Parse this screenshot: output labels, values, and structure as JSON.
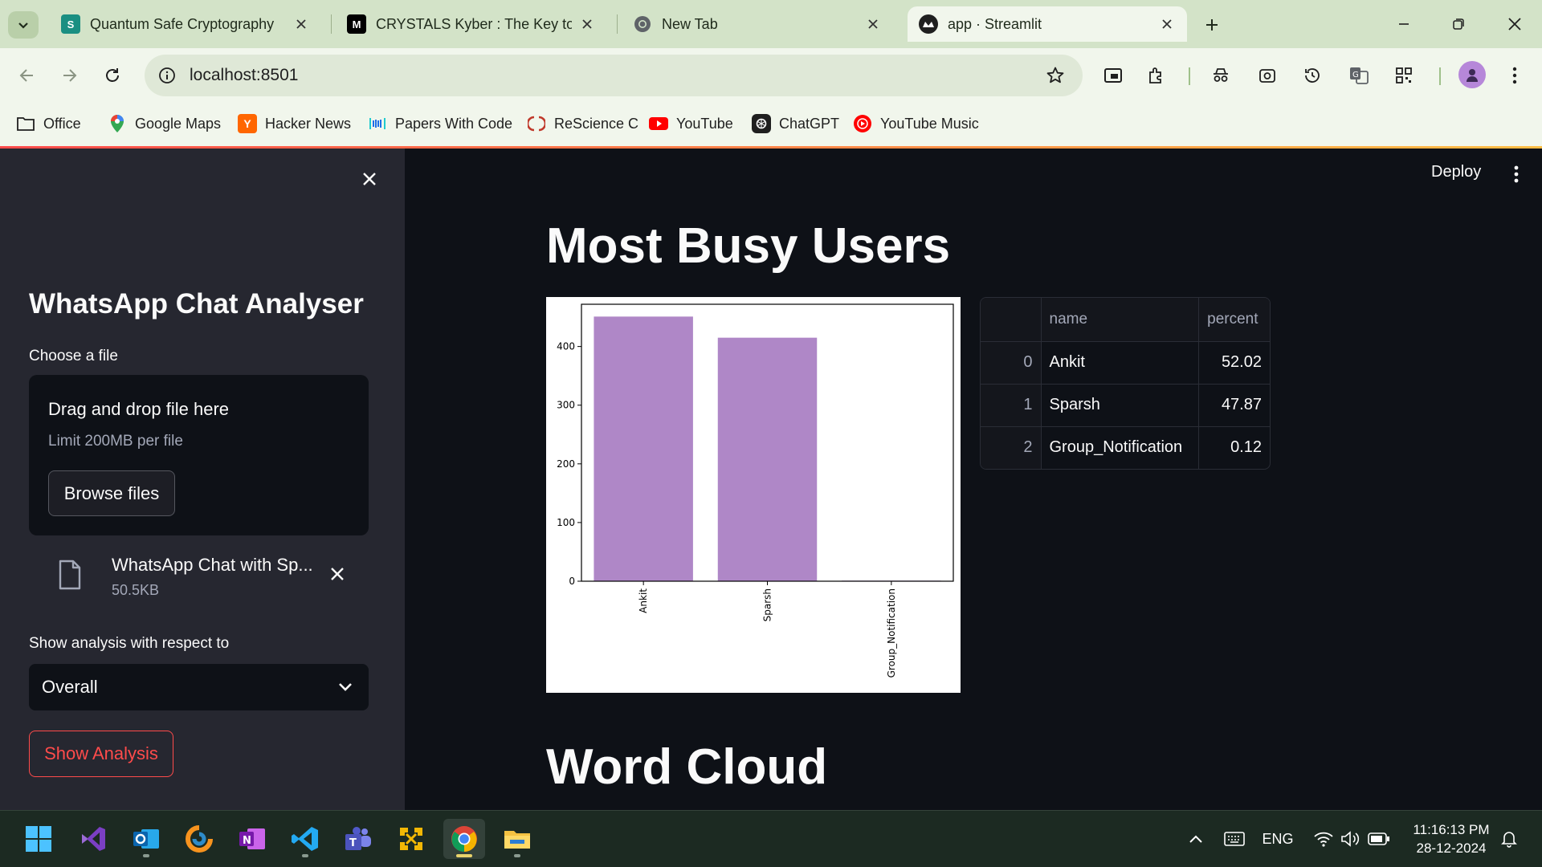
{
  "browser": {
    "tabs": [
      {
        "title": "Quantum Safe Cryptography",
        "icon": "sharepoint-icon"
      },
      {
        "title": "CRYSTALS Kyber : The Key to Po",
        "icon": "medium-icon"
      },
      {
        "title": "New Tab",
        "icon": "chrome-icon"
      },
      {
        "title": "app · Streamlit",
        "icon": "streamlit-icon"
      }
    ],
    "url": "localhost:8501",
    "bookmarks": [
      {
        "label": "Office",
        "icon": "folder-icon"
      },
      {
        "label": "Google Maps",
        "icon": "maps-icon"
      },
      {
        "label": "Hacker News",
        "icon": "hacker-news-icon"
      },
      {
        "label": "Papers With Code",
        "icon": "papers-with-code-icon"
      },
      {
        "label": "ReScience C",
        "icon": "rescience-icon"
      },
      {
        "label": "YouTube",
        "icon": "youtube-icon"
      },
      {
        "label": "ChatGPT",
        "icon": "chatgpt-icon"
      },
      {
        "label": "YouTube Music",
        "icon": "youtube-music-icon"
      }
    ]
  },
  "sidebar": {
    "title": "WhatsApp Chat Analyser",
    "uploader_label": "Choose a file",
    "dropzone_title": "Drag and drop file here",
    "dropzone_limit": "Limit 200MB per file",
    "browse_label": "Browse files",
    "file_name": "WhatsApp Chat with Sp...",
    "file_size": "50.5KB",
    "select_label": "Show analysis with respect to",
    "select_value": "Overall",
    "show_button": "Show Analysis"
  },
  "main": {
    "deploy_label": "Deploy",
    "heading": "Most Busy Users",
    "heading2": "Word Cloud",
    "table": {
      "columns": [
        "",
        "name",
        "percent"
      ],
      "rows": [
        {
          "index": "0",
          "name": "Ankit",
          "percent": "52.02"
        },
        {
          "index": "1",
          "name": "Sparsh",
          "percent": "47.87"
        },
        {
          "index": "2",
          "name": "Group_Notification",
          "percent": "0.12"
        }
      ]
    }
  },
  "chart_data": {
    "type": "bar",
    "categories": [
      "Ankit",
      "Sparsh",
      "Group_Notification"
    ],
    "values": [
      451,
      415,
      1
    ],
    "ylim": [
      0,
      472
    ],
    "yticks": [
      0,
      100,
      200,
      300,
      400
    ],
    "bar_color": "#af87c7",
    "grid": false,
    "title": "",
    "xlabel": "",
    "ylabel": ""
  },
  "taskbar": {
    "apps": [
      "windows-start-icon",
      "visual-studio-icon",
      "outlook-icon",
      "app-icon",
      "onenote-icon",
      "vscode-icon",
      "teams-icon",
      "app2-icon",
      "chrome-icon",
      "file-explorer-icon"
    ],
    "language": "ENG",
    "time": "11:16:13 PM",
    "date": "28-12-2024"
  },
  "colors": {
    "accent": "#ff4b4b",
    "sidebar_bg": "#262730",
    "main_bg": "#0e1117",
    "chrome_bg": "#f1f6ec"
  }
}
